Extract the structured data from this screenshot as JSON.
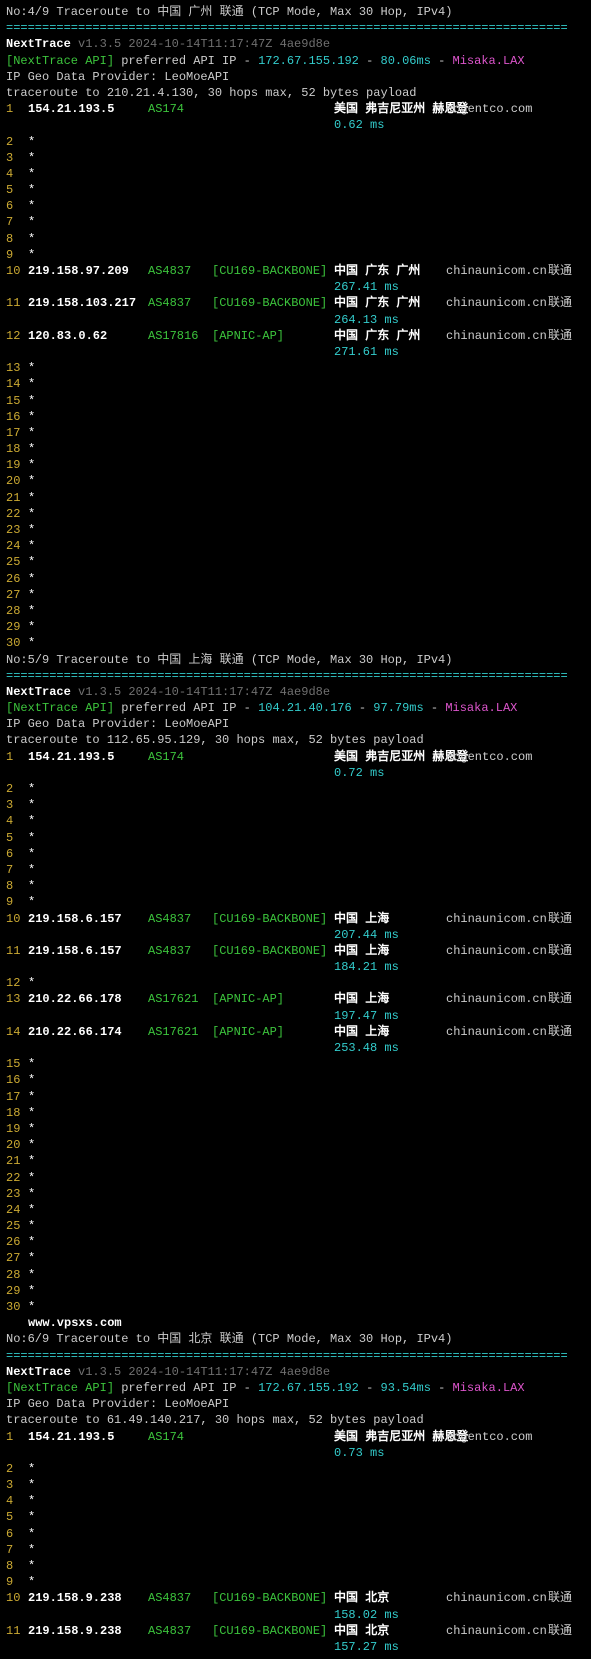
{
  "watermark": "www.vpsxs.com",
  "blocks": [
    {
      "title": "No:4/9 Traceroute to 中国 广州 联通 (TCP Mode, Max 30 Hop, IPv4)",
      "divider": "==============================================================================",
      "nexttrace": "NextTrace",
      "version": "v1.3.5 2024-10-14T11:17:47Z 4ae9d8e",
      "api_tag": "[NextTrace API]",
      "api_text": "preferred API IP -",
      "api_ip": "172.67.155.192",
      "api_ms": "80.06ms",
      "api_loc": "Misaka.LAX",
      "geo": "IP Geo Data Provider: LeoMoeAPI",
      "trace": "traceroute to 210.21.4.130, 30 hops max, 52 bytes payload",
      "hops": [
        {
          "n": "1",
          "ip": "154.21.193.5",
          "asn": "AS174",
          "net": "",
          "loc": "美国 弗吉尼亚州 赫恩登",
          "dom": "cogentco.com",
          "isp": "",
          "ms": "0.62 ms"
        },
        {
          "n": "2",
          "star": "*"
        },
        {
          "n": "3",
          "star": "*"
        },
        {
          "n": "4",
          "star": "*"
        },
        {
          "n": "5",
          "star": "*"
        },
        {
          "n": "6",
          "star": "*"
        },
        {
          "n": "7",
          "star": "*"
        },
        {
          "n": "8",
          "star": "*"
        },
        {
          "n": "9",
          "star": "*"
        },
        {
          "n": "10",
          "ip": "219.158.97.209",
          "asn": "AS4837",
          "net": "[CU169-BACKBONE]",
          "loc": "中国 广东 广州",
          "dom": "chinaunicom.cn",
          "isp": "联通",
          "ms": "267.41 ms"
        },
        {
          "n": "11",
          "ip": "219.158.103.217",
          "asn": "AS4837",
          "net": "[CU169-BACKBONE]",
          "loc": "中国 广东 广州",
          "dom": "chinaunicom.cn",
          "isp": "联通",
          "ms": "264.13 ms"
        },
        {
          "n": "12",
          "ip": "120.83.0.62",
          "asn": "AS17816",
          "net": "[APNIC-AP]",
          "loc": "中国 广东 广州",
          "dom": "chinaunicom.cn",
          "isp": "联通",
          "ms": "271.61 ms"
        },
        {
          "n": "13",
          "star": "*"
        },
        {
          "n": "14",
          "star": "*"
        },
        {
          "n": "15",
          "star": "*"
        },
        {
          "n": "16",
          "star": "*"
        },
        {
          "n": "17",
          "star": "*"
        },
        {
          "n": "18",
          "star": "*"
        },
        {
          "n": "19",
          "star": "*"
        },
        {
          "n": "20",
          "star": "*"
        },
        {
          "n": "21",
          "star": "*"
        },
        {
          "n": "22",
          "star": "*"
        },
        {
          "n": "23",
          "star": "*"
        },
        {
          "n": "24",
          "star": "*"
        },
        {
          "n": "25",
          "star": "*"
        },
        {
          "n": "26",
          "star": "*"
        },
        {
          "n": "27",
          "star": "*"
        },
        {
          "n": "28",
          "star": "*"
        },
        {
          "n": "29",
          "star": "*"
        },
        {
          "n": "30",
          "star": "*"
        }
      ]
    },
    {
      "title": "No:5/9 Traceroute to 中国 上海 联通 (TCP Mode, Max 30 Hop, IPv4)",
      "divider": "==============================================================================",
      "nexttrace": "NextTrace",
      "version": "v1.3.5 2024-10-14T11:17:47Z 4ae9d8e",
      "api_tag": "[NextTrace API]",
      "api_text": "preferred API IP -",
      "api_ip": "104.21.40.176",
      "api_ms": "97.79ms",
      "api_loc": "Misaka.LAX",
      "geo": "IP Geo Data Provider: LeoMoeAPI",
      "trace": "traceroute to 112.65.95.129, 30 hops max, 52 bytes payload",
      "hops": [
        {
          "n": "1",
          "ip": "154.21.193.5",
          "asn": "AS174",
          "net": "",
          "loc": "美国 弗吉尼亚州 赫恩登",
          "dom": "cogentco.com",
          "isp": "",
          "ms": "0.72 ms"
        },
        {
          "n": "2",
          "star": "*"
        },
        {
          "n": "3",
          "star": "*"
        },
        {
          "n": "4",
          "star": "*"
        },
        {
          "n": "5",
          "star": "*"
        },
        {
          "n": "6",
          "star": "*"
        },
        {
          "n": "7",
          "star": "*"
        },
        {
          "n": "8",
          "star": "*"
        },
        {
          "n": "9",
          "star": "*"
        },
        {
          "n": "10",
          "ip": "219.158.6.157",
          "asn": "AS4837",
          "net": "[CU169-BACKBONE]",
          "loc": "中国 上海",
          "dom": "chinaunicom.cn",
          "isp": "联通",
          "ms": "207.44 ms"
        },
        {
          "n": "11",
          "ip": "219.158.6.157",
          "asn": "AS4837",
          "net": "[CU169-BACKBONE]",
          "loc": "中国 上海",
          "dom": "chinaunicom.cn",
          "isp": "联通",
          "ms": "184.21 ms"
        },
        {
          "n": "12",
          "star": "*"
        },
        {
          "n": "13",
          "ip": "210.22.66.178",
          "asn": "AS17621",
          "net": "[APNIC-AP]",
          "loc": "中国 上海",
          "dom": "chinaunicom.cn",
          "isp": "联通",
          "ms": "197.47 ms"
        },
        {
          "n": "14",
          "ip": "210.22.66.174",
          "asn": "AS17621",
          "net": "[APNIC-AP]",
          "loc": "中国 上海",
          "dom": "chinaunicom.cn",
          "isp": "联通",
          "ms": "253.48 ms"
        },
        {
          "n": "15",
          "star": "*"
        },
        {
          "n": "16",
          "star": "*"
        },
        {
          "n": "17",
          "star": "*"
        },
        {
          "n": "18",
          "star": "*"
        },
        {
          "n": "19",
          "star": "*"
        },
        {
          "n": "20",
          "star": "*"
        },
        {
          "n": "21",
          "star": "*"
        },
        {
          "n": "22",
          "star": "*"
        },
        {
          "n": "23",
          "star": "*"
        },
        {
          "n": "24",
          "star": "*"
        },
        {
          "n": "25",
          "star": "*"
        },
        {
          "n": "26",
          "star": "*"
        },
        {
          "n": "27",
          "star": "*"
        },
        {
          "n": "28",
          "star": "*"
        },
        {
          "n": "29",
          "star": "*"
        },
        {
          "n": "30",
          "star": "*"
        }
      ],
      "watermark_after": true
    },
    {
      "title": "No:6/9 Traceroute to 中国 北京 联通 (TCP Mode, Max 30 Hop, IPv4)",
      "divider": "==============================================================================",
      "nexttrace": "NextTrace",
      "version": "v1.3.5 2024-10-14T11:17:47Z 4ae9d8e",
      "api_tag": "[NextTrace API]",
      "api_text": "preferred API IP -",
      "api_ip": "172.67.155.192",
      "api_ms": "93.54ms",
      "api_loc": "Misaka.LAX",
      "geo": "IP Geo Data Provider: LeoMoeAPI",
      "trace": "traceroute to 61.49.140.217, 30 hops max, 52 bytes payload",
      "hops": [
        {
          "n": "1",
          "ip": "154.21.193.5",
          "asn": "AS174",
          "net": "",
          "loc": "美国 弗吉尼亚州 赫恩登",
          "dom": "cogentco.com",
          "isp": "",
          "ms": "0.73 ms"
        },
        {
          "n": "2",
          "star": "*"
        },
        {
          "n": "3",
          "star": "*"
        },
        {
          "n": "4",
          "star": "*"
        },
        {
          "n": "5",
          "star": "*"
        },
        {
          "n": "6",
          "star": "*"
        },
        {
          "n": "7",
          "star": "*"
        },
        {
          "n": "8",
          "star": "*"
        },
        {
          "n": "9",
          "star": "*"
        },
        {
          "n": "10",
          "ip": "219.158.9.238",
          "asn": "AS4837",
          "net": "[CU169-BACKBONE]",
          "loc": "中国 北京",
          "dom": "chinaunicom.cn",
          "isp": "联通",
          "ms": "158.02 ms"
        },
        {
          "n": "11",
          "ip": "219.158.9.238",
          "asn": "AS4837",
          "net": "[CU169-BACKBONE]",
          "loc": "中国 北京",
          "dom": "chinaunicom.cn",
          "isp": "联通",
          "ms": "157.27 ms"
        }
      ]
    }
  ]
}
